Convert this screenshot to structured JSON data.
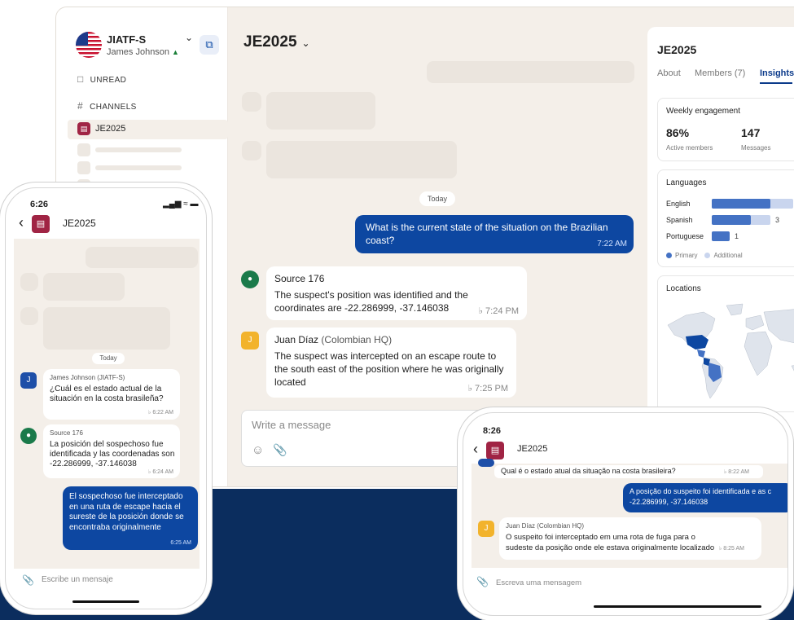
{
  "desktop": {
    "workspace": {
      "name": "JIATF-S",
      "user": "James Johnson",
      "presence": "▲"
    },
    "nav": {
      "unread": "UNREAD",
      "channels": "CHANNELS"
    },
    "channel": "JE2025",
    "chat": {
      "title": "JE2025",
      "day": "Today",
      "messages": [
        {
          "direction": "out",
          "text": "What is the current state of the situation on the Brazilian coast?",
          "time": "7:22 AM"
        },
        {
          "direction": "in",
          "sender": "Source 176",
          "text": "The suspect's position was identified and the coordinates are -22.286999, -37.146038",
          "time": "7:24 PM"
        },
        {
          "direction": "in",
          "sender": "Juan Díaz",
          "sender_org": "(Colombian HQ)",
          "avatar": "J",
          "text": "The suspect was intercepted on an escape route to the south east of the position where he was originally located",
          "time": "7:25 PM"
        }
      ],
      "composer_placeholder": "Write a message"
    },
    "insights": {
      "title": "JE2025",
      "tabs": [
        "About",
        "Members (7)",
        "Insights"
      ],
      "weekly": {
        "title": "Weekly engagement",
        "active_value": "86%",
        "active_label": "Active members",
        "messages_value": "147",
        "messages_label": "Messages"
      },
      "languages": {
        "title": "Languages",
        "items": [
          {
            "name": "English",
            "primary": 0.72,
            "total": 1.0,
            "count": ""
          },
          {
            "name": "Spanish",
            "primary": 0.48,
            "total": 0.72,
            "count": "3"
          },
          {
            "name": "Portuguese",
            "primary": 0.22,
            "total": 0.22,
            "count": "1"
          }
        ],
        "legend_primary": "Primary",
        "legend_additional": "Additional"
      },
      "locations": {
        "title": "Locations"
      }
    }
  },
  "phone_left": {
    "status_time": "6:26",
    "title": "JE2025",
    "day": "Today",
    "messages": [
      {
        "sender": "James Johnson (JIATF-S)",
        "avatar": "J",
        "text": "¿Cuál es el estado actual de la situación en la costa brasileña?",
        "time": "6:22 AM"
      },
      {
        "sender": "Source 176",
        "text": "La posición del sospechoso fue identificada y las coordenadas son -22.286999, -37.146038",
        "time": "6:24 AM"
      },
      {
        "direction": "out",
        "text": "El sospechoso fue interceptado en una ruta de escape hacia el sureste de la posición donde se encontraba originalmente",
        "time": "6:25 AM"
      }
    ],
    "composer_placeholder": "Escribe un mensaje"
  },
  "phone_right": {
    "status_time": "8:26",
    "title": "JE2025",
    "messages": [
      {
        "text": "Qual é o estado atual da situação na costa brasileira?",
        "time": "8:22 AM"
      },
      {
        "direction": "out",
        "text": "A posição do suspeito foi identificada e as c",
        "text2": "-22.286999, -37.146038"
      },
      {
        "sender": "Juan Díaz (Colombian HQ)",
        "avatar": "J",
        "text": "O suspeito foi interceptado em uma rota de fuga para o sudeste da posição onde ele estava originalmente localizado",
        "time": "8:25 AM"
      }
    ],
    "composer_placeholder": "Escreva uma mensagem"
  },
  "colors": {
    "navy": "#0b2d5e",
    "accent": "#0d47a1",
    "channel": "#a02444",
    "source": "#1a7a4a",
    "juan": "#f2b32c"
  }
}
